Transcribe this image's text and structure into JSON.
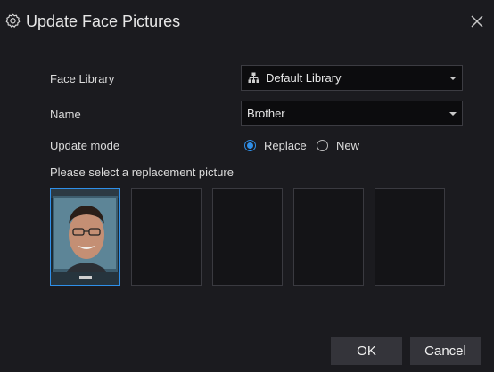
{
  "dialog": {
    "title": "Update Face Pictures",
    "title_icon": "gear-icon",
    "close_icon": "close-icon"
  },
  "form": {
    "face_library": {
      "label": "Face Library",
      "value": "Default Library",
      "icon": "hierarchy-icon"
    },
    "name": {
      "label": "Name",
      "value": "Brother"
    },
    "update_mode": {
      "label": "Update mode",
      "options": [
        {
          "label": "Replace",
          "selected": true
        },
        {
          "label": "New",
          "selected": false
        }
      ]
    },
    "replacement_prompt": "Please select a replacement picture",
    "thumbnails": [
      {
        "slot": 1,
        "has_picture": true,
        "selected": true
      },
      {
        "slot": 2,
        "has_picture": false,
        "selected": false
      },
      {
        "slot": 3,
        "has_picture": false,
        "selected": false
      },
      {
        "slot": 4,
        "has_picture": false,
        "selected": false
      },
      {
        "slot": 5,
        "has_picture": false,
        "selected": false
      }
    ]
  },
  "footer": {
    "ok_label": "OK",
    "cancel_label": "Cancel"
  },
  "colors": {
    "background": "#1b1b1f",
    "accent": "#2f8fe8",
    "button": "#34343a"
  }
}
